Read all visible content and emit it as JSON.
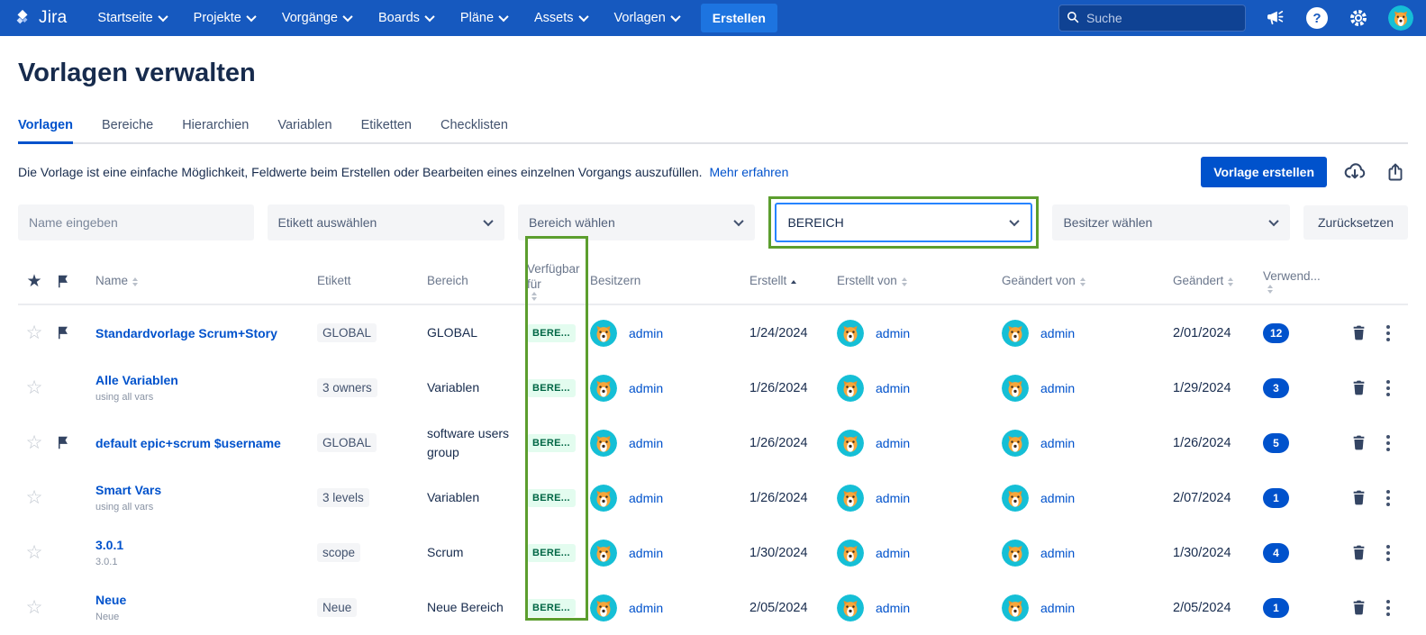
{
  "colors": {
    "nav_bg": "#1659BF",
    "accent_blue": "#0052CC",
    "annotation_green": "#5C9E2E",
    "available_pill_bg": "#E3FCEF",
    "available_pill_text": "#006644",
    "badge_bg": "#0052CC"
  },
  "nav": {
    "brand": "Jira",
    "items": [
      {
        "label": "Startseite"
      },
      {
        "label": "Projekte"
      },
      {
        "label": "Vorgänge"
      },
      {
        "label": "Boards"
      },
      {
        "label": "Pläne"
      },
      {
        "label": "Assets"
      },
      {
        "label": "Vorlagen"
      }
    ],
    "create_button": "Erstellen",
    "search_placeholder": "Suche"
  },
  "page": {
    "title": "Vorlagen verwalten",
    "tabs": [
      {
        "label": "Vorlagen",
        "active": true
      },
      {
        "label": "Bereiche",
        "active": false
      },
      {
        "label": "Hierarchien",
        "active": false
      },
      {
        "label": "Variablen",
        "active": false
      },
      {
        "label": "Etiketten",
        "active": false
      },
      {
        "label": "Checklisten",
        "active": false
      }
    ],
    "description": "Die Vorlage ist eine einfache Möglichkeit, Feldwerte beim Erstellen oder Bearbeiten eines einzelnen Vorgangs auszufüllen.",
    "learn_more_link": "Mehr erfahren",
    "create_button": "Vorlage erstellen"
  },
  "filters": {
    "name_placeholder": "Name eingeben",
    "label_select": "Etikett auswählen",
    "scope_select": "Bereich wählen",
    "highlighted_select_value": "BEREICH",
    "owner_select": "Besitzer wählen",
    "reset_button": "Zurücksetzen"
  },
  "table": {
    "columns": {
      "name": "Name",
      "label": "Etikett",
      "scope": "Bereich",
      "available": "Verfügbar für",
      "owners": "Besitzern",
      "created": "Erstellt",
      "created_by": "Erstellt von",
      "modified_by": "Geändert von",
      "modified": "Geändert",
      "usage": "Verwend..."
    },
    "rows": [
      {
        "name": "Standardvorlage Scrum+Story",
        "subtitle": "",
        "label": "GLOBAL",
        "scope": "GLOBAL",
        "available": "BERE...",
        "owner": "admin",
        "created": "1/24/2024",
        "created_by": "admin",
        "modified_by": "admin",
        "modified": "2/01/2024",
        "usage": "12",
        "flagged": true
      },
      {
        "name": "Alle Variablen",
        "subtitle": "using all vars",
        "label": "3 owners",
        "scope": "Variablen",
        "available": "BERE...",
        "owner": "admin",
        "created": "1/26/2024",
        "created_by": "admin",
        "modified_by": "admin",
        "modified": "1/29/2024",
        "usage": "3",
        "flagged": false
      },
      {
        "name": "default epic+scrum $username",
        "subtitle": "",
        "label": "GLOBAL",
        "scope": "software users group",
        "available": "BERE...",
        "owner": "admin",
        "created": "1/26/2024",
        "created_by": "admin",
        "modified_by": "admin",
        "modified": "1/26/2024",
        "usage": "5",
        "flagged": true
      },
      {
        "name": "Smart Vars",
        "subtitle": "using all vars",
        "label": "3 levels",
        "scope": "Variablen",
        "available": "BERE...",
        "owner": "admin",
        "created": "1/26/2024",
        "created_by": "admin",
        "modified_by": "admin",
        "modified": "2/07/2024",
        "usage": "1",
        "flagged": false
      },
      {
        "name": "3.0.1",
        "subtitle": "3.0.1",
        "label": "scope",
        "scope": "Scrum",
        "available": "BERE...",
        "owner": "admin",
        "created": "1/30/2024",
        "created_by": "admin",
        "modified_by": "admin",
        "modified": "1/30/2024",
        "usage": "4",
        "flagged": false
      },
      {
        "name": "Neue",
        "subtitle": "Neue",
        "label": "Neue",
        "scope": "Neue Bereich",
        "available": "BERE...",
        "owner": "admin",
        "created": "2/05/2024",
        "created_by": "admin",
        "modified_by": "admin",
        "modified": "2/05/2024",
        "usage": "1",
        "flagged": false
      }
    ]
  }
}
